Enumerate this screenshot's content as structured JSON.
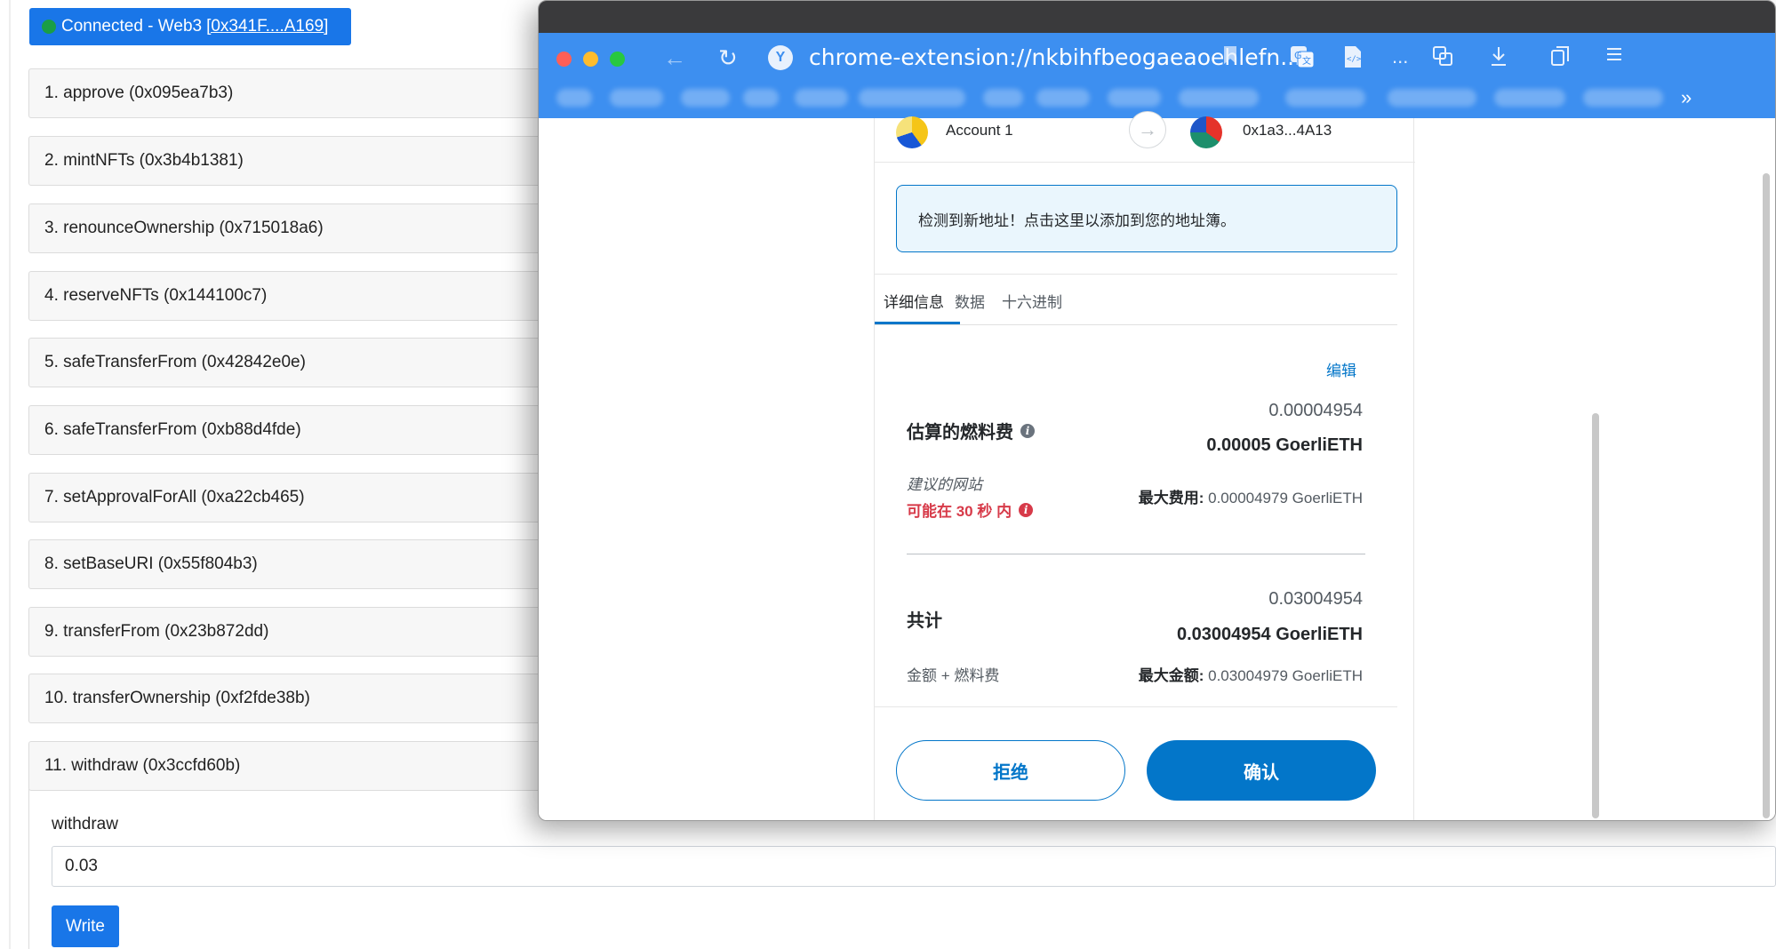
{
  "dapp": {
    "connect_button": {
      "label": "Connected - Web3",
      "address": "[0x341F....A169]",
      "status_color": "#1a9e45"
    },
    "functions": [
      "1. approve (0x095ea7b3)",
      "2. mintNFTs (0x3b4b1381)",
      "3. renounceOwnership (0x715018a6)",
      "4. reserveNFTs (0x144100c7)",
      "5. safeTransferFrom (0x42842e0e)",
      "6. safeTransferFrom (0xb88d4fde)",
      "7. setApprovalForAll (0xa22cb465)",
      "8. setBaseURI (0x55f804b3)",
      "9. transferFrom (0x23b872dd)",
      "10. transferOwnership (0xf2fde38b)",
      "11. withdraw (0x3ccfd60b)"
    ],
    "withdraw": {
      "param_label": "withdraw",
      "value": "0.03",
      "write_label": "Write"
    }
  },
  "browser": {
    "url": "chrome-extension://nkbihfbeogaeaoehlefn...",
    "url_site_icon": "Y",
    "more_label": "...",
    "bookmarks_more": "»"
  },
  "metamask": {
    "from_account": "Account 1",
    "to_address": "0x1a3...4A13",
    "new_address_notice": "检测到新地址！点击这里以添加到您的地址簿。",
    "tabs": [
      "详细信息",
      "数据",
      "十六进制"
    ],
    "active_tab": 0,
    "edit_label": "编辑",
    "gas": {
      "label": "估算的燃料费",
      "amount": "0.00004954",
      "amount_bold": "0.00005 GoerliETH",
      "suggested_site": "建议的网站",
      "likely_in": "可能在 30 秒 内",
      "max_fee_label": "最大费用:",
      "max_fee_value": "0.00004979 GoerliETH"
    },
    "total": {
      "label": "共计",
      "amount": "0.03004954",
      "amount_bold": "0.03004954 GoerliETH",
      "sub_label": "金额 + 燃料费",
      "max_amount_label": "最大金额:",
      "max_amount_value": "0.03004979 GoerliETH"
    },
    "reject_label": "拒绝",
    "confirm_label": "确认",
    "accent_color": "#0376c9",
    "error_color": "#d73a49"
  }
}
